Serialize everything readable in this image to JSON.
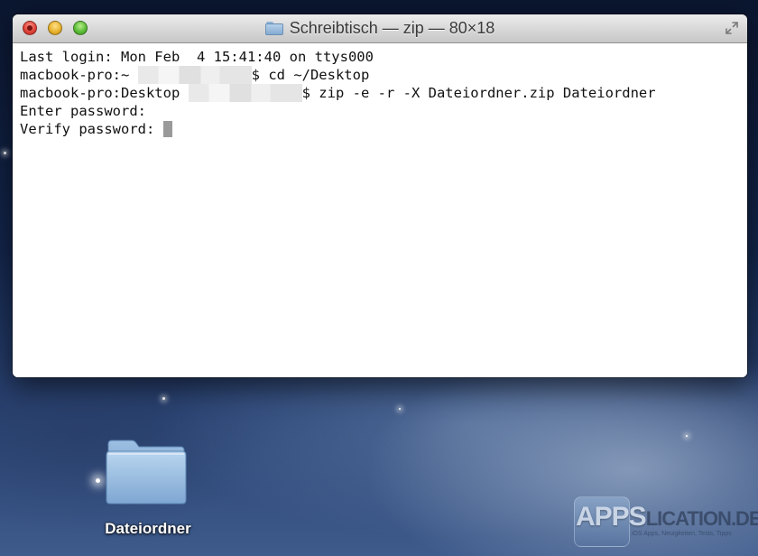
{
  "window": {
    "title": "Schreibtisch — zip — 80×18"
  },
  "terminal": {
    "lines": {
      "l1": "Last login: Mon Feb  4 15:41:40 on ttys000",
      "l2_prefix": "macbook-pro:~ ",
      "l2_suffix": "$ cd ~/Desktop",
      "l3_prefix": "macbook-pro:Desktop ",
      "l3_suffix": "$ zip -e -r -X Dateiordner.zip Dateiordner",
      "l4": "Enter password:",
      "l5": "Verify password: "
    }
  },
  "desktop": {
    "folder_label": "Dateiordner"
  },
  "watermark": {
    "text_apps": "APPS",
    "text_rest": "LICATION.DE",
    "subtitle": "iOS Apps, Neuigkeiten, Tests, Tipps"
  },
  "icons": {
    "close": "close-icon",
    "minimize": "minimize-icon",
    "zoom": "zoom-icon",
    "title_folder": "folder-icon",
    "fullscreen": "fullscreen-icon",
    "desktop_folder": "folder-icon"
  },
  "colors": {
    "close": "#e0443a",
    "minimize": "#e8b32f",
    "zoom": "#5bbd38",
    "terminal_background": "#ffffff",
    "terminal_text": "#111111",
    "cursor": "#9a9a9a"
  }
}
